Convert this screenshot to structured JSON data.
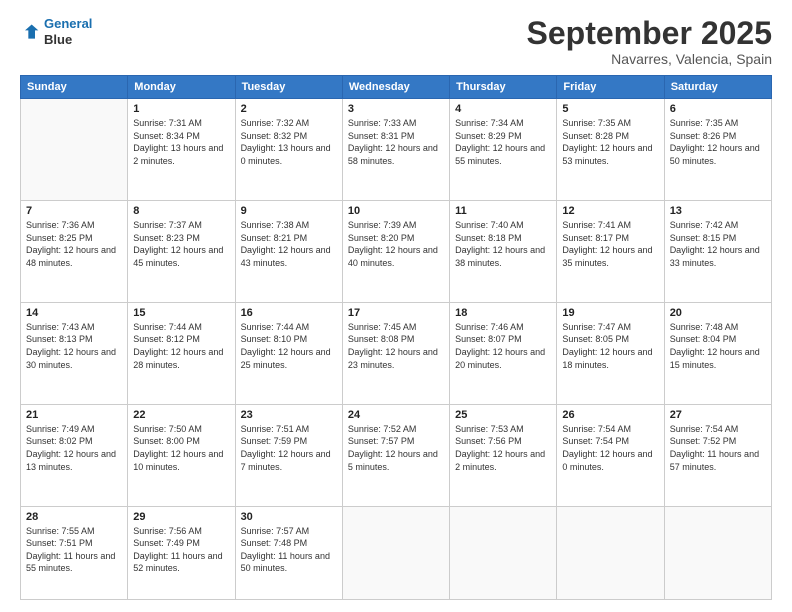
{
  "header": {
    "logo_line1": "General",
    "logo_line2": "Blue",
    "month_title": "September 2025",
    "location": "Navarres, Valencia, Spain"
  },
  "weekdays": [
    "Sunday",
    "Monday",
    "Tuesday",
    "Wednesday",
    "Thursday",
    "Friday",
    "Saturday"
  ],
  "weeks": [
    [
      {
        "day": "",
        "sunrise": "",
        "sunset": "",
        "daylight": ""
      },
      {
        "day": "1",
        "sunrise": "7:31 AM",
        "sunset": "8:34 PM",
        "daylight": "13 hours and 2 minutes."
      },
      {
        "day": "2",
        "sunrise": "7:32 AM",
        "sunset": "8:32 PM",
        "daylight": "13 hours and 0 minutes."
      },
      {
        "day": "3",
        "sunrise": "7:33 AM",
        "sunset": "8:31 PM",
        "daylight": "12 hours and 58 minutes."
      },
      {
        "day": "4",
        "sunrise": "7:34 AM",
        "sunset": "8:29 PM",
        "daylight": "12 hours and 55 minutes."
      },
      {
        "day": "5",
        "sunrise": "7:35 AM",
        "sunset": "8:28 PM",
        "daylight": "12 hours and 53 minutes."
      },
      {
        "day": "6",
        "sunrise": "7:35 AM",
        "sunset": "8:26 PM",
        "daylight": "12 hours and 50 minutes."
      }
    ],
    [
      {
        "day": "7",
        "sunrise": "7:36 AM",
        "sunset": "8:25 PM",
        "daylight": "12 hours and 48 minutes."
      },
      {
        "day": "8",
        "sunrise": "7:37 AM",
        "sunset": "8:23 PM",
        "daylight": "12 hours and 45 minutes."
      },
      {
        "day": "9",
        "sunrise": "7:38 AM",
        "sunset": "8:21 PM",
        "daylight": "12 hours and 43 minutes."
      },
      {
        "day": "10",
        "sunrise": "7:39 AM",
        "sunset": "8:20 PM",
        "daylight": "12 hours and 40 minutes."
      },
      {
        "day": "11",
        "sunrise": "7:40 AM",
        "sunset": "8:18 PM",
        "daylight": "12 hours and 38 minutes."
      },
      {
        "day": "12",
        "sunrise": "7:41 AM",
        "sunset": "8:17 PM",
        "daylight": "12 hours and 35 minutes."
      },
      {
        "day": "13",
        "sunrise": "7:42 AM",
        "sunset": "8:15 PM",
        "daylight": "12 hours and 33 minutes."
      }
    ],
    [
      {
        "day": "14",
        "sunrise": "7:43 AM",
        "sunset": "8:13 PM",
        "daylight": "12 hours and 30 minutes."
      },
      {
        "day": "15",
        "sunrise": "7:44 AM",
        "sunset": "8:12 PM",
        "daylight": "12 hours and 28 minutes."
      },
      {
        "day": "16",
        "sunrise": "7:44 AM",
        "sunset": "8:10 PM",
        "daylight": "12 hours and 25 minutes."
      },
      {
        "day": "17",
        "sunrise": "7:45 AM",
        "sunset": "8:08 PM",
        "daylight": "12 hours and 23 minutes."
      },
      {
        "day": "18",
        "sunrise": "7:46 AM",
        "sunset": "8:07 PM",
        "daylight": "12 hours and 20 minutes."
      },
      {
        "day": "19",
        "sunrise": "7:47 AM",
        "sunset": "8:05 PM",
        "daylight": "12 hours and 18 minutes."
      },
      {
        "day": "20",
        "sunrise": "7:48 AM",
        "sunset": "8:04 PM",
        "daylight": "12 hours and 15 minutes."
      }
    ],
    [
      {
        "day": "21",
        "sunrise": "7:49 AM",
        "sunset": "8:02 PM",
        "daylight": "12 hours and 13 minutes."
      },
      {
        "day": "22",
        "sunrise": "7:50 AM",
        "sunset": "8:00 PM",
        "daylight": "12 hours and 10 minutes."
      },
      {
        "day": "23",
        "sunrise": "7:51 AM",
        "sunset": "7:59 PM",
        "daylight": "12 hours and 7 minutes."
      },
      {
        "day": "24",
        "sunrise": "7:52 AM",
        "sunset": "7:57 PM",
        "daylight": "12 hours and 5 minutes."
      },
      {
        "day": "25",
        "sunrise": "7:53 AM",
        "sunset": "7:56 PM",
        "daylight": "12 hours and 2 minutes."
      },
      {
        "day": "26",
        "sunrise": "7:54 AM",
        "sunset": "7:54 PM",
        "daylight": "12 hours and 0 minutes."
      },
      {
        "day": "27",
        "sunrise": "7:54 AM",
        "sunset": "7:52 PM",
        "daylight": "11 hours and 57 minutes."
      }
    ],
    [
      {
        "day": "28",
        "sunrise": "7:55 AM",
        "sunset": "7:51 PM",
        "daylight": "11 hours and 55 minutes."
      },
      {
        "day": "29",
        "sunrise": "7:56 AM",
        "sunset": "7:49 PM",
        "daylight": "11 hours and 52 minutes."
      },
      {
        "day": "30",
        "sunrise": "7:57 AM",
        "sunset": "7:48 PM",
        "daylight": "11 hours and 50 minutes."
      },
      {
        "day": "",
        "sunrise": "",
        "sunset": "",
        "daylight": ""
      },
      {
        "day": "",
        "sunrise": "",
        "sunset": "",
        "daylight": ""
      },
      {
        "day": "",
        "sunrise": "",
        "sunset": "",
        "daylight": ""
      },
      {
        "day": "",
        "sunrise": "",
        "sunset": "",
        "daylight": ""
      }
    ]
  ]
}
